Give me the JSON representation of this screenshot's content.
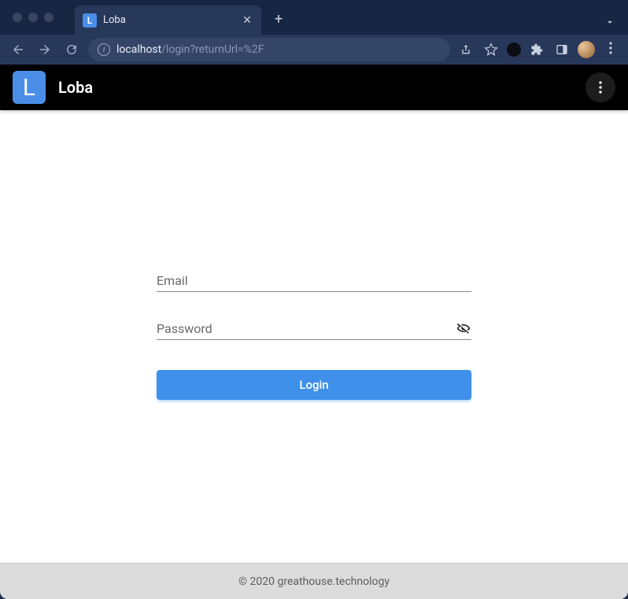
{
  "browser": {
    "tab": {
      "favicon_letter": "L",
      "title": "Loba"
    },
    "url": {
      "host": "localhost",
      "path": "/login?returnUrl=%2F"
    }
  },
  "app": {
    "header": {
      "logo_letter": "L",
      "name": "Loba"
    },
    "login": {
      "email_label": "Email",
      "email_value": "",
      "password_label": "Password",
      "password_value": "",
      "submit_label": "Login"
    },
    "footer": {
      "text": "© 2020 greathouse.technology"
    }
  },
  "colors": {
    "accent": "#3e90ea",
    "header_bg": "#000000"
  }
}
